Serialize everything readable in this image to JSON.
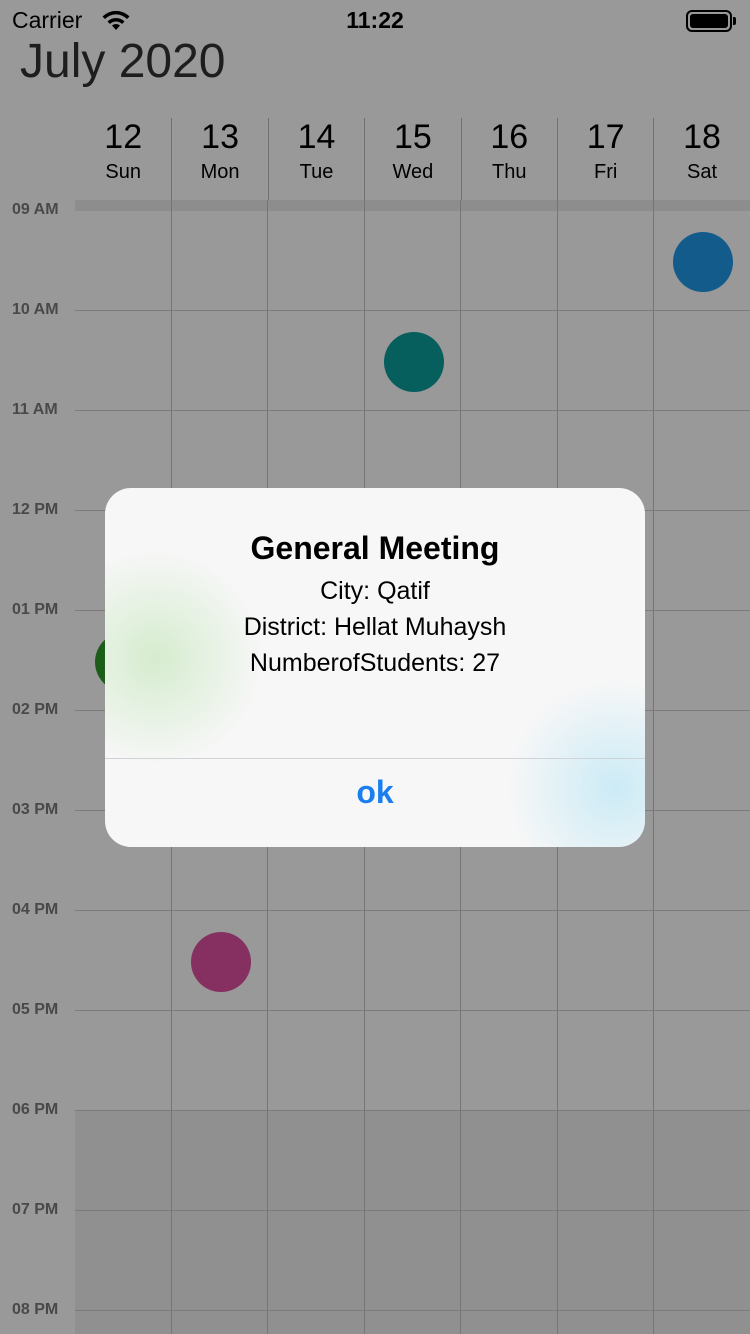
{
  "status_bar": {
    "carrier": "Carrier",
    "time": "11:22"
  },
  "calendar": {
    "month_title": "July 2020",
    "days": [
      {
        "num": "12",
        "name": "Sun"
      },
      {
        "num": "13",
        "name": "Mon"
      },
      {
        "num": "14",
        "name": "Tue"
      },
      {
        "num": "15",
        "name": "Wed"
      },
      {
        "num": "16",
        "name": "Thu"
      },
      {
        "num": "17",
        "name": "Fri"
      },
      {
        "num": "18",
        "name": "Sat"
      }
    ],
    "time_labels": [
      "09 AM",
      "10 AM",
      "11 AM",
      "12 PM",
      "01 PM",
      "02 PM",
      "03 PM",
      "04 PM",
      "05 PM",
      "06 PM",
      "07 PM",
      "08 PM"
    ],
    "event_colors": {
      "sat": "#1e98e8",
      "wed": "#0a9d9b",
      "sun": "#2e9c2a",
      "mon": "#e050a4"
    }
  },
  "alert": {
    "title": "General Meeting",
    "city": "City: Qatif",
    "district": "District: Hellat Muhaysh",
    "students": "NumberofStudents: 27",
    "ok_label": "ok"
  }
}
